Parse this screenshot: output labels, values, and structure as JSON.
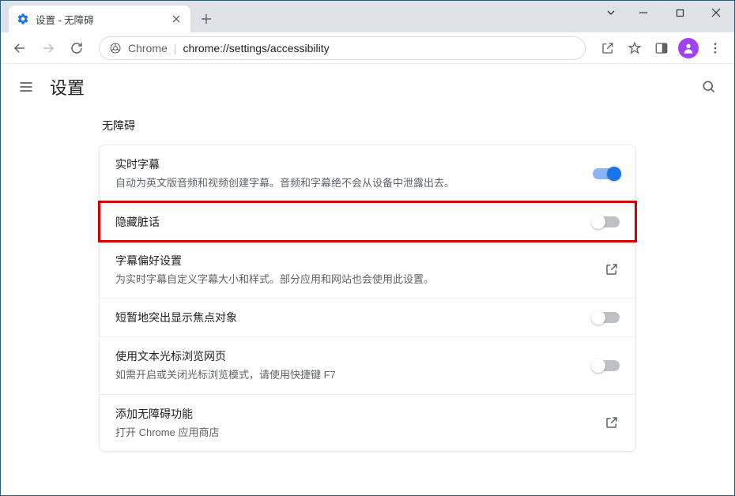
{
  "window": {
    "tab_title": "设置 - 无障碍"
  },
  "omnibox": {
    "scheme_label": "Chrome",
    "url": "chrome://settings/accessibility"
  },
  "header": {
    "title": "设置"
  },
  "section": {
    "title": "无障碍"
  },
  "rows": {
    "live_caption": {
      "label": "实时字幕",
      "desc": "自动为英文版音频和视频创建字幕。音频和字幕绝不会从设备中泄露出去。",
      "on": true
    },
    "hide_profanity": {
      "label": "隐藏脏话",
      "on": false
    },
    "caption_prefs": {
      "label": "字幕偏好设置",
      "desc": "为实时字幕自定义字幕大小和样式。部分应用和网站也会使用此设置。"
    },
    "focus_highlight": {
      "label": "短暂地突出显示焦点对象",
      "on": false
    },
    "caret_browsing": {
      "label": "使用文本光标浏览网页",
      "desc": "如需开启或关闭光标浏览模式，请使用快捷键 F7",
      "on": false
    },
    "add_a11y": {
      "label": "添加无障碍功能",
      "desc": "打开 Chrome 应用商店"
    }
  }
}
